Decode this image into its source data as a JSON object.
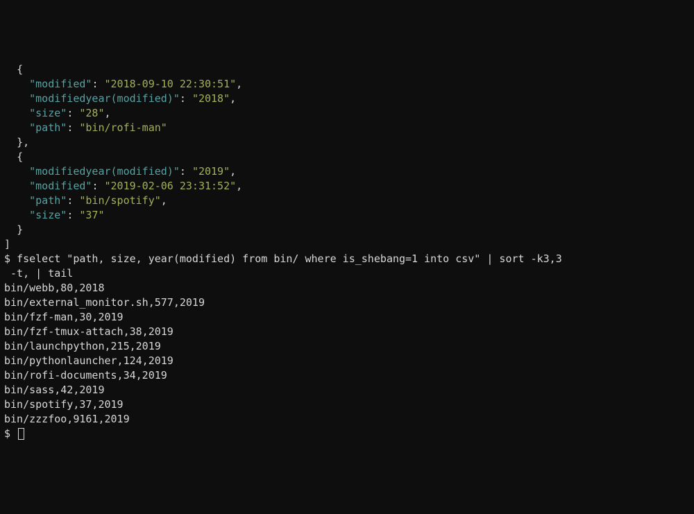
{
  "json_output": {
    "obj1": {
      "modified_key": "\"modified\"",
      "modified_val": "\"2018-09-10 22:30:51\"",
      "modifiedyear_key": "\"modifiedyear(modified)\"",
      "modifiedyear_val": "\"2018\"",
      "size_key": "\"size\"",
      "size_val": "\"28\"",
      "path_key": "\"path\"",
      "path_val": "\"bin/rofi-man\""
    },
    "obj2": {
      "modifiedyear_key": "\"modifiedyear(modified)\"",
      "modifiedyear_val": "\"2019\"",
      "modified_key": "\"modified\"",
      "modified_val": "\"2019-02-06 23:31:52\"",
      "path_key": "\"path\"",
      "path_val": "\"bin/spotify\"",
      "size_key": "\"size\"",
      "size_val": "\"37\""
    }
  },
  "prompt_symbol": "$ ",
  "command_line1": "fselect \"path, size, year(modified) from bin/ where is_shebang=1 into csv\" | sort -k3,3",
  "command_line2": " -t, | tail",
  "csv_output": [
    "bin/webb,80,2018",
    "bin/external_monitor.sh,577,2019",
    "bin/fzf-man,30,2019",
    "bin/fzf-tmux-attach,38,2019",
    "bin/launchpython,215,2019",
    "bin/pythonlauncher,124,2019",
    "bin/rofi-documents,34,2019",
    "bin/sass,42,2019",
    "bin/spotify,37,2019",
    "bin/zzzfoo,9161,2019"
  ],
  "braces": {
    "open_curly": "{",
    "close_curly": "}",
    "close_curly_comma": "},",
    "close_bracket": "]",
    "colon": ": ",
    "comma": ","
  },
  "indent": {
    "i1": "  ",
    "i2": "    "
  }
}
